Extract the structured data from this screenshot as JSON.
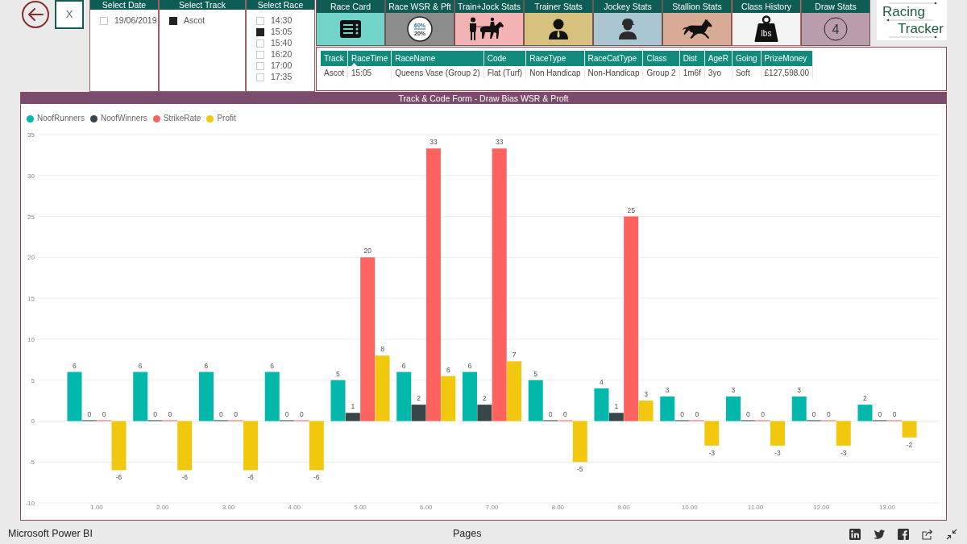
{
  "clear_button": {
    "label": "X"
  },
  "slicers": [
    {
      "title": "Select Date",
      "items": [
        {
          "label": "19/06/2019",
          "checked": false
        }
      ]
    },
    {
      "title": "Select Track",
      "items": [
        {
          "label": "Ascot",
          "checked": true
        }
      ]
    },
    {
      "title": "Select Race",
      "items": [
        {
          "label": "14:30",
          "checked": false
        },
        {
          "label": "15:05",
          "checked": true
        },
        {
          "label": "15:40",
          "checked": false
        },
        {
          "label": "16:20",
          "checked": false
        },
        {
          "label": "17:00",
          "checked": false
        },
        {
          "label": "17:35",
          "checked": false
        }
      ]
    }
  ],
  "tabs": [
    {
      "label": "Race Card",
      "kind": "list",
      "color": "#72d3c9",
      "selected": false
    },
    {
      "label": "Race WSR & Pft",
      "kind": "ratio",
      "color": "#8c8c8c",
      "icon_texts": [
        "60%",
        "20%"
      ],
      "selected": false
    },
    {
      "label": "Train+Jock Stats",
      "kind": "trainer-horse",
      "color": "#f3b3b3",
      "selected": false
    },
    {
      "label": "Trainer Stats",
      "kind": "trainer",
      "color": "#d6c27c",
      "selected": false
    },
    {
      "label": "Jockey Stats",
      "kind": "jockey",
      "color": "#a9c6d1",
      "selected": false
    },
    {
      "label": "Stallion Stats",
      "kind": "stallion",
      "color": "#d9aa95",
      "selected": false
    },
    {
      "label": "Class History",
      "kind": "weight",
      "color": "#f4f4f4",
      "icon_texts": [
        "lbs"
      ],
      "selected": true
    },
    {
      "label": "Draw Stats",
      "kind": "number",
      "color": "#b99dad",
      "icon_texts": [
        "4"
      ],
      "selected": false
    }
  ],
  "logo": {
    "lines": [
      "Racing",
      "Tracker"
    ]
  },
  "race_table": {
    "columns": [
      {
        "label": "Track",
        "sorted": false
      },
      {
        "label": "RaceTime",
        "sorted": true
      },
      {
        "label": "RaceName",
        "sorted": false
      },
      {
        "label": "Code",
        "sorted": false
      },
      {
        "label": "RaceType",
        "sorted": false
      },
      {
        "label": "RaceCatType",
        "sorted": false
      },
      {
        "label": "Class",
        "sorted": false
      },
      {
        "label": "Dist",
        "sorted": false
      },
      {
        "label": "AgeR",
        "sorted": false
      },
      {
        "label": "Going",
        "sorted": false
      },
      {
        "label": "PrizeMoney",
        "sorted": false
      }
    ],
    "rows": [
      [
        "Ascot",
        "15:05",
        "Queens Vase (Group 2)",
        "Flat (Turf)",
        "Non Handicap",
        "Non-Handicap",
        "Group 2",
        "1m6f",
        "3yo",
        "Soft",
        "£127,598.00"
      ]
    ]
  },
  "chart": {
    "chart_data": {
      "type": "bar",
      "title": "Track & Code Form - Draw Bias WSR & Proft",
      "legend": "top-left",
      "grid": true,
      "categories": [
        "1.00",
        "2.00",
        "3.00",
        "4.00",
        "5.00",
        "6.00",
        "7.00",
        "8.00",
        "9.00",
        "10.00",
        "11.00",
        "12.00",
        "13.00"
      ],
      "ylim": [
        -10,
        35
      ],
      "yticks": [
        -10,
        -5,
        0,
        5,
        10,
        15,
        20,
        25,
        30,
        35
      ],
      "series": [
        {
          "name": "NoofRunners",
          "color": "#01b8aa",
          "values": [
            6,
            6,
            6,
            6,
            5,
            6,
            6,
            5,
            4,
            3,
            3,
            3,
            2
          ],
          "value_labels": [
            "6",
            "6",
            "6",
            "6",
            "5",
            "6",
            "6",
            "5",
            "4",
            "3",
            "3",
            "3",
            "2"
          ]
        },
        {
          "name": "NoofWinners",
          "color": "#374649",
          "values": [
            0,
            0,
            0,
            0,
            1,
            2,
            2,
            0,
            1,
            0,
            0,
            0,
            0
          ],
          "value_labels": [
            "0",
            "0",
            "0",
            "0",
            "1",
            "2",
            "2",
            "0",
            "1",
            "0",
            "0",
            "0",
            "0"
          ]
        },
        {
          "name": "StrikeRate",
          "color": "#fd625e",
          "values": [
            0,
            0,
            0,
            0,
            20,
            33.3,
            33.3,
            0,
            25,
            0,
            0,
            0,
            0
          ],
          "value_labels": [
            "0",
            "0",
            "0",
            "0",
            "20",
            "33",
            "33",
            "0",
            "25",
            "0",
            "0",
            "0",
            "0"
          ]
        },
        {
          "name": "Profit",
          "color": "#f2c80f",
          "values": [
            -6,
            -6,
            -6,
            -6,
            8,
            5.5,
            7.3,
            -5,
            2.5,
            -3,
            -3,
            -3,
            -2
          ],
          "value_labels": [
            "-6",
            "-6",
            "-6",
            "-6",
            "8",
            "6",
            "7",
            "-5",
            "3",
            "-3",
            "-3",
            "-3",
            "-2"
          ]
        }
      ]
    }
  },
  "status_bar": {
    "app_name": "Microsoft Power BI",
    "pages_label": "Pages"
  }
}
